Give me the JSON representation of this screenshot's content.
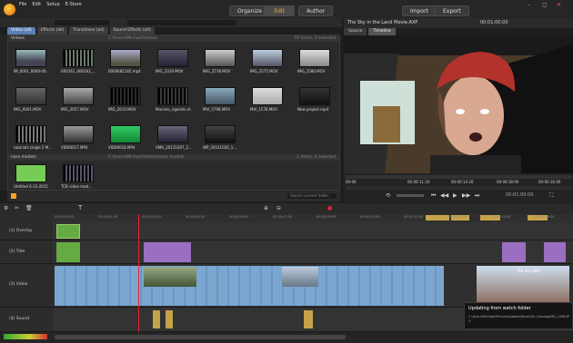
{
  "menu": {
    "file": "File",
    "edit": "Edit",
    "setup": "Setup",
    "estore": "E-Store"
  },
  "modes": {
    "organize": "Organize",
    "edit": "Edit",
    "author": "Author"
  },
  "header_right": {
    "import": "Import",
    "export": "Export"
  },
  "library": {
    "tabs": [
      "Video (all)",
      "Effects (all)",
      "Transitions (all)",
      "Sound Effects (all)"
    ],
    "sections": [
      {
        "name": "Videos",
        "path": "C:\\Users\\Michael\\Videos",
        "status": "70 items, 0 selected"
      },
      {
        "name": "naro models",
        "path": "C:\\Users\\Michael\\Videos\\naro models",
        "status": "2 items, 0 selected"
      }
    ],
    "items": [
      "IM_0001_0000-00...",
      "0X0161_000162_...",
      "0000682165.mp4",
      "IMG_2329.MOV",
      "IMG_2578.MOV",
      "IMG_2575.MOV",
      "IMG_2580.MOV",
      "IMG_0001.MOV",
      "IMG_2657.MOV",
      "IMG_2610.MOV",
      "Marcelo_rigendo of...",
      "MVI_5798.MOV",
      "MVI_1578.MOV",
      "New project.mp4",
      "tutorials single 2 M...",
      "VID00017.MP4",
      "VID00018.MP4",
      "VMH_20131007_2...",
      "WP_20141020_1..."
    ],
    "items2": [
      "Untitled 6-15-2015",
      "TCB video mod..."
    ]
  },
  "preview": {
    "title": "The Sky in the Land Movie.AXP",
    "timecode": "00:01:00:00",
    "tabs": [
      "Source",
      "Timeline"
    ],
    "times": [
      "00:00",
      "00:00:11:20",
      "00:00:14:20",
      "00:00:18:00",
      "00:00:16:00"
    ]
  },
  "timeline": {
    "tracks": [
      {
        "label": "(1) Overlay"
      },
      {
        "label": "(2) Title"
      },
      {
        "label": "(3) Video"
      },
      {
        "label": "(4) Sound"
      }
    ],
    "ruler": [
      "00:00:00:00",
      "00:00:01:30",
      "00:00:03:00",
      "00:00:04:30",
      "00:00:06:00",
      "00:00:07:30",
      "00:00:09:00",
      "00:00:10:30",
      "00:00:12:00",
      "00:00:13:30",
      "00:00:15:00",
      "00:00:16:30"
    ],
    "clip_label": "The day after"
  },
  "toast": {
    "title": "Updating from watch folder",
    "body": "C:\\Users\\Michael\\Pictures\\Adobe\\Revel\\My Catalog\\IMG_1286.JPG"
  },
  "search": {
    "placeholder": "Search current folder"
  },
  "colors": {
    "accent": "#f5a623",
    "clip_blue": "#7aa6d0",
    "title_purple": "#9a6ec0",
    "audio_gold": "#c6a34a"
  }
}
